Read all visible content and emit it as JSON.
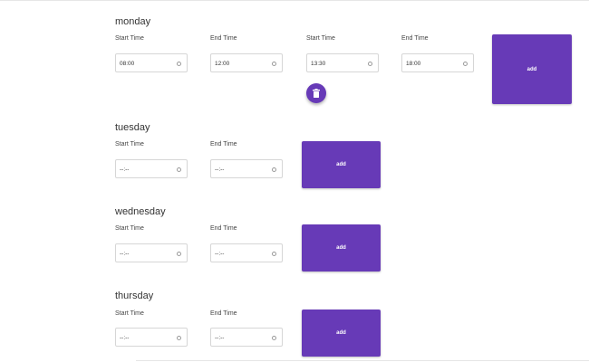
{
  "days": [
    {
      "name": "monday",
      "slots": [
        {
          "label": "Start Time",
          "value": "08:00"
        },
        {
          "label": "End Time",
          "value": "12:00"
        },
        {
          "label": "Start Time",
          "value": "13:30"
        },
        {
          "label": "End Time",
          "value": "18:00"
        }
      ],
      "add_label": "add",
      "delete_icon": "trash-icon"
    },
    {
      "name": "tuesday",
      "slots": [
        {
          "label": "Start Time",
          "value": "--:--"
        },
        {
          "label": "End Time",
          "value": "--:--"
        }
      ],
      "add_label": "add"
    },
    {
      "name": "wednesday",
      "slots": [
        {
          "label": "Start Time",
          "value": "--:--"
        },
        {
          "label": "End Time",
          "value": "--:--"
        }
      ],
      "add_label": "add"
    },
    {
      "name": "thursday",
      "slots": [
        {
          "label": "Start Time",
          "value": "--:--"
        },
        {
          "label": "End Time",
          "value": "--:--"
        }
      ],
      "add_label": "add"
    }
  ],
  "colors": {
    "accent": "#673ab7",
    "border": "#d6d6d6",
    "text": "#333333"
  }
}
